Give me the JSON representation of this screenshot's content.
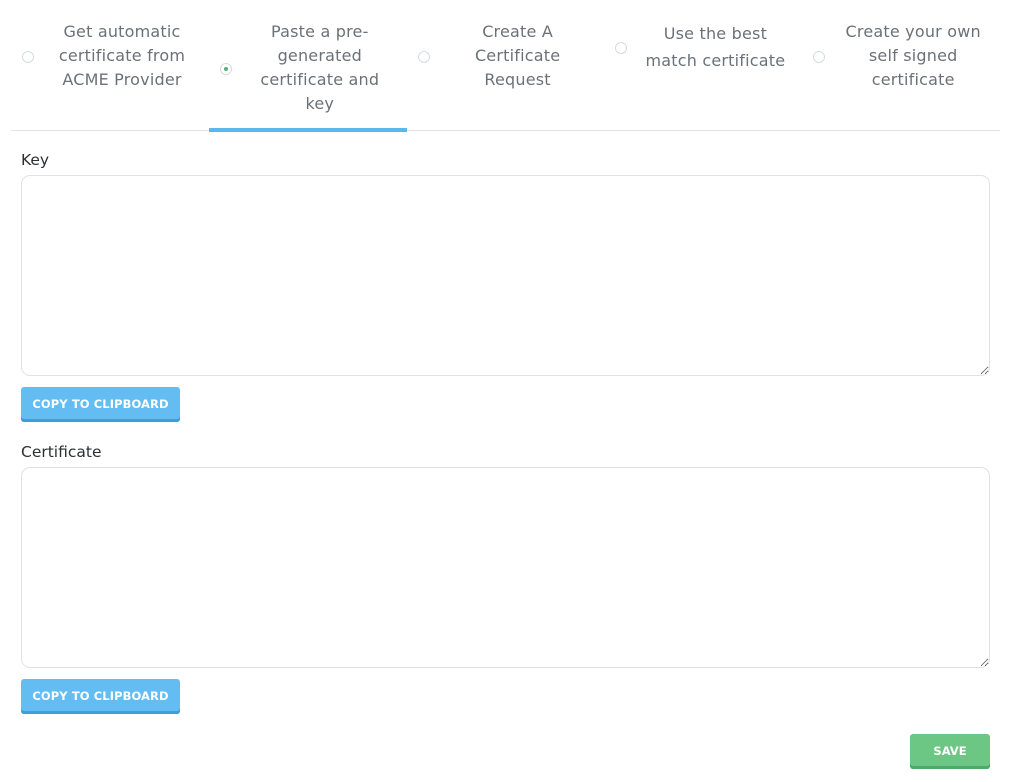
{
  "tabs": [
    {
      "label": "Get automatic\ncertificate from\nACME Provider",
      "selected": false
    },
    {
      "label": "Paste a pre-\ngenerated\ncertificate and\nkey",
      "selected": true
    },
    {
      "label": "Create A\nCertificate\nRequest",
      "selected": false
    },
    {
      "label": "Use the best\nmatch certificate",
      "selected": false
    },
    {
      "label": "Create your own\nself signed\ncertificate",
      "selected": false
    }
  ],
  "key_field": {
    "label": "Key",
    "value": "",
    "copy_label": "COPY TO CLIPBOARD"
  },
  "certificate_field": {
    "label": "Certificate",
    "value": "",
    "copy_label": "COPY TO CLIPBOARD"
  },
  "save_label": "SAVE",
  "colors": {
    "active_tab_underline": "#5bb8ee",
    "radio_checked": "#4fb37a",
    "copy_button": "#63bdf2",
    "save_button": "#6cc784"
  }
}
